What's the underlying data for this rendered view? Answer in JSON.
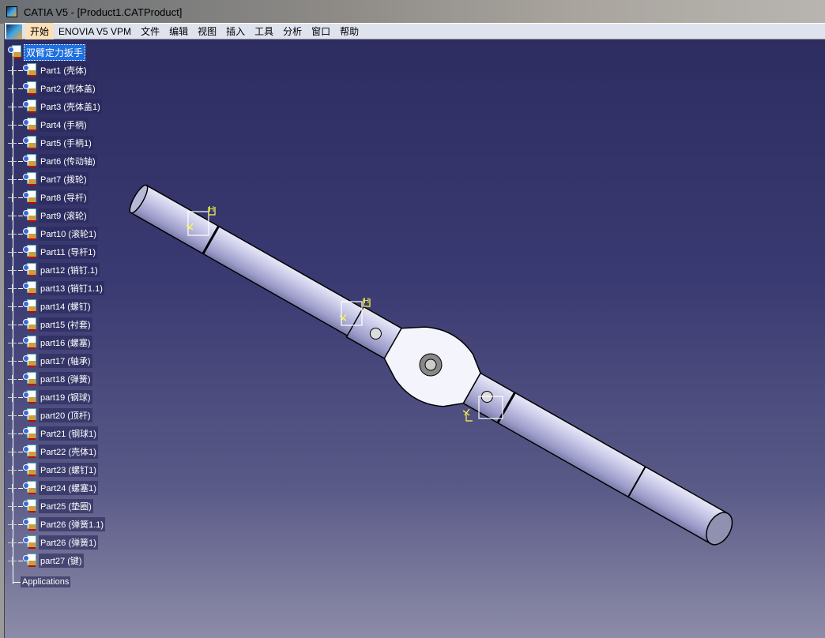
{
  "window": {
    "title": "CATIA V5 - [Product1.CATProduct]"
  },
  "menu": [
    "开始",
    "ENOVIA V5 VPM",
    "文件",
    "编辑",
    "视图",
    "插入",
    "工具",
    "分析",
    "窗口",
    "帮助"
  ],
  "tree": {
    "root": "双臂定力扳手",
    "parts": [
      "Part1 (壳体)",
      "Part2 (壳体盖)",
      "Part3 (壳体盖1)",
      "Part4 (手柄)",
      "Part5 (手柄1)",
      "Part6 (传动轴)",
      "Part7 (拨轮)",
      "Part8 (导杆)",
      "Part9 (滚轮)",
      "Part10 (滚轮1)",
      "Part11 (导杆1)",
      "part12 (销钉.1)",
      "part13 (销钉1.1)",
      "part14 (螺钉)",
      "part15 (衬套)",
      "part16 (螺塞)",
      "part17 (轴承)",
      "part18 (弹簧)",
      "part19 (钢球)",
      "part20 (顶杆)",
      "Part21 (钢球1)",
      "Part22 (壳体1)",
      "Part23 (螺钉1)",
      "Part24 (螺塞1)",
      "Part25 (垫圈)",
      "Part26 (弹簧1.1)",
      "Part26 (弹簧1)",
      "part27 (键)"
    ],
    "applications": "Applications"
  },
  "constraint_label": "H"
}
